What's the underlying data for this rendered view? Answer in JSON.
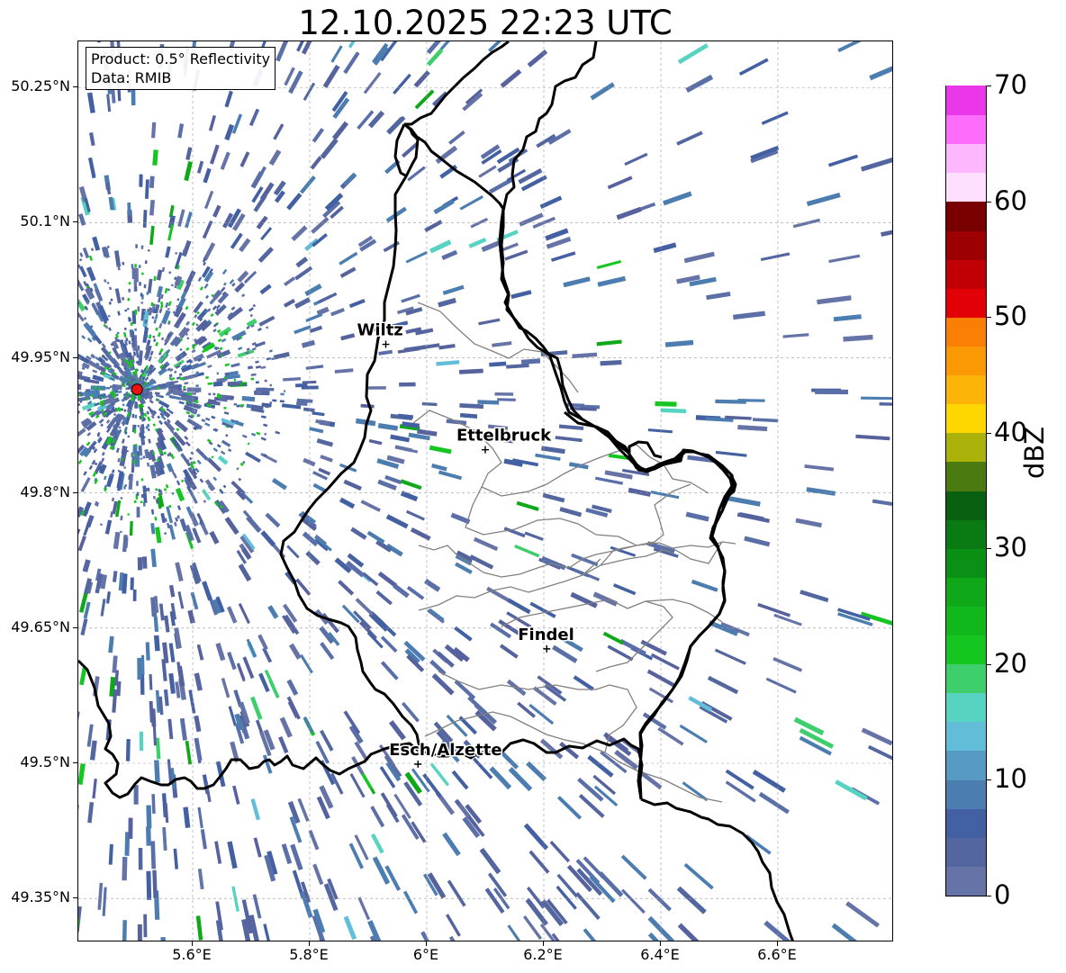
{
  "title": "12.10.2025 22:23 UTC",
  "info": {
    "line1": "Product: 0.5° Reflectivity",
    "line2": "Data: RMIB"
  },
  "map": {
    "lon_range": [
      5.4,
      6.8
    ],
    "lat_range": [
      49.3,
      50.3
    ],
    "lat_ticks": [
      {
        "value": 50.25,
        "label": "50.25°N"
      },
      {
        "value": 50.1,
        "label": "50.1°N"
      },
      {
        "value": 49.95,
        "label": "49.95°N"
      },
      {
        "value": 49.8,
        "label": "49.8°N"
      },
      {
        "value": 49.65,
        "label": "49.65°N"
      },
      {
        "value": 49.5,
        "label": "49.5°N"
      },
      {
        "value": 49.35,
        "label": "49.35°N"
      }
    ],
    "lon_ticks": [
      {
        "value": 5.6,
        "label": "5.6°E"
      },
      {
        "value": 5.8,
        "label": "5.8°E"
      },
      {
        "value": 6.0,
        "label": "6°E"
      },
      {
        "value": 6.2,
        "label": "6.2°E"
      },
      {
        "value": 6.4,
        "label": "6.4°E"
      },
      {
        "value": 6.6,
        "label": "6.6°E"
      }
    ],
    "radar_site": {
      "lon": 5.505,
      "lat": 49.915,
      "color": "#ee1111"
    },
    "cities": [
      {
        "name": "Wiltz",
        "lon": 5.93,
        "lat": 49.965
      },
      {
        "name": "Ettelbruck",
        "lon": 6.1,
        "lat": 49.848
      },
      {
        "name": "Findel",
        "lon": 6.205,
        "lat": 49.627
      },
      {
        "name": "Esch/Alzette",
        "lon": 5.985,
        "lat": 49.499
      }
    ]
  },
  "colorbar": {
    "label": "dBZ",
    "min": 0,
    "max": 70,
    "tick_labels": [
      "0",
      "10",
      "20",
      "30",
      "40",
      "50",
      "60",
      "70"
    ],
    "colors": [
      "#6673a6",
      "#5466a0",
      "#4360a2",
      "#4c7db0",
      "#579bc4",
      "#62bdd8",
      "#56d3c1",
      "#3ecf6c",
      "#14c61f",
      "#10b81c",
      "#0ea818",
      "#0b9016",
      "#0a7a12",
      "#096010",
      "#4a7a10",
      "#abb20a",
      "#fed700",
      "#fdb408",
      "#fb9904",
      "#fb7f05",
      "#e20006",
      "#c10005",
      "#9c0003",
      "#780000",
      "#fee0fe",
      "#fdb7fd",
      "#fc6dfc",
      "#e937e9"
    ]
  }
}
